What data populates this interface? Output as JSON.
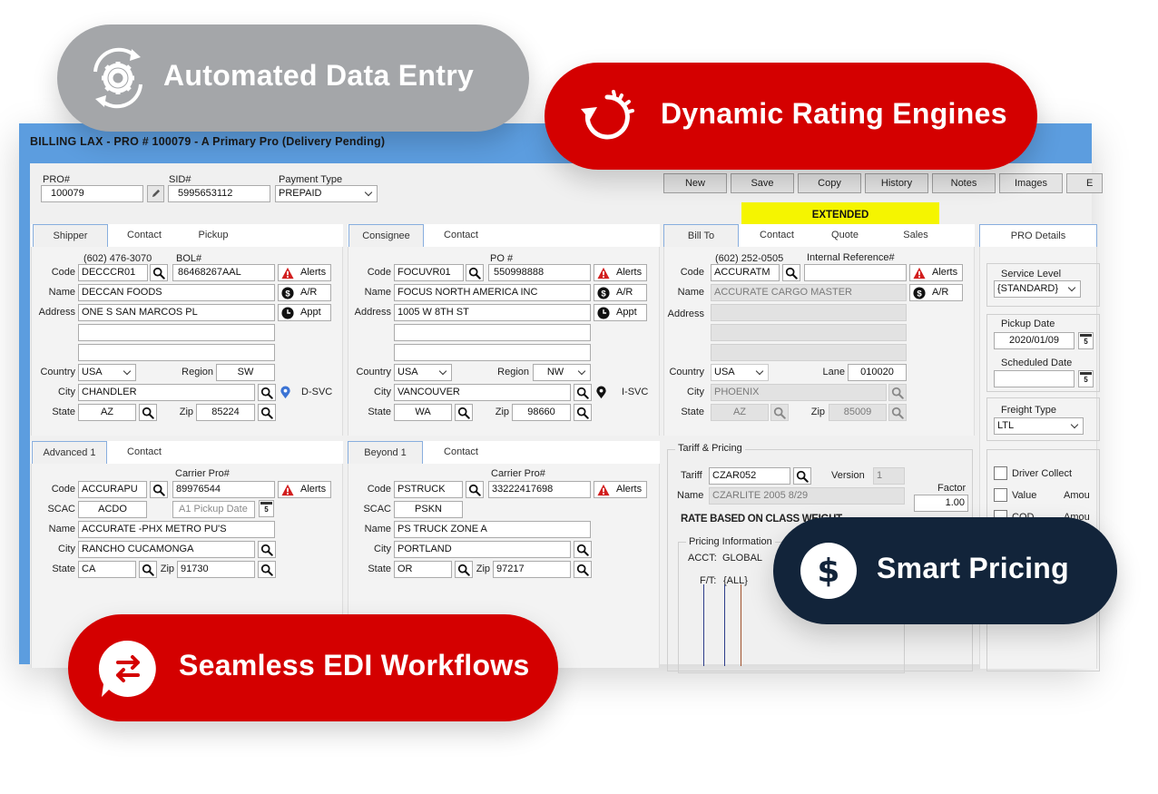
{
  "badges": {
    "automated": {
      "label": "Automated Data Entry",
      "color": "#a4a6a9",
      "icon": "gear-sync-icon"
    },
    "dynamic": {
      "label": "Dynamic Rating Engines",
      "color": "#d40000",
      "icon": "speed-refresh-icon"
    },
    "smart": {
      "label": "Smart Pricing",
      "color": "#12243a",
      "icon": "dollar-icon"
    },
    "edi": {
      "label": "Seamless EDI Workflows",
      "color": "#d40000",
      "icon": "exchange-chat-icon"
    }
  },
  "window": {
    "title": "BILLING  LAX - PRO # 100079 - A Primary Pro (Delivery Pending)"
  },
  "header": {
    "pro_label": "PRO#",
    "pro_value": "100079",
    "sid_label": "SID#",
    "sid_value": "5995653112",
    "payment_label": "Payment Type",
    "payment_value": "PREPAID"
  },
  "toolbar": {
    "new": "New",
    "save": "Save",
    "copy": "Copy",
    "history": "History",
    "notes": "Notes",
    "images": "Images",
    "more": "E"
  },
  "status": "EXTENDED",
  "labels": {
    "code": "Code",
    "name": "Name",
    "address": "Address",
    "country": "Country",
    "region": "Region",
    "city": "City",
    "state": "State",
    "zip": "Zip",
    "scac": "SCAC",
    "lane": "Lane",
    "alerts": "Alerts",
    "ar": "A/R",
    "appt": "Appt",
    "carrier_pro": "Carrier Pro#"
  },
  "shipper": {
    "tabs": [
      "Shipper",
      "Contact",
      "Pickup"
    ],
    "phone": "(602) 476-3070",
    "ref_label": "BOL#",
    "code": "DECCCR01",
    "ref": "86468267AAL",
    "name": "DECCAN FOODS",
    "address": "ONE S SAN MARCOS PL",
    "country": "USA",
    "region": "SW",
    "city": "CHANDLER",
    "svc": "D-SVC",
    "state": "AZ",
    "zip": "85224"
  },
  "consignee": {
    "tabs": [
      "Consignee",
      "Contact"
    ],
    "ref_label": "PO #",
    "code": "FOCUVR01",
    "ref": "550998888",
    "name": "FOCUS NORTH AMERICA INC",
    "address": "1005 W 8TH ST",
    "country": "USA",
    "region": "NW",
    "city": "VANCOUVER",
    "svc": "I-SVC",
    "state": "WA",
    "zip": "98660"
  },
  "billto": {
    "tabs": [
      "Bill To",
      "Contact",
      "Quote",
      "Sales"
    ],
    "phone": "(602) 252-0505",
    "ref_label": "Internal Reference#",
    "code": "ACCURATM",
    "ref": "",
    "name": "ACCURATE CARGO MASTER",
    "country": "USA",
    "lane": "010020",
    "city": "PHOENIX",
    "state": "AZ",
    "zip": "85009"
  },
  "advanced": {
    "tabs": [
      "Advanced 1",
      "Contact"
    ],
    "code": "ACCURAPU",
    "carrier_pro": "89976544",
    "scac": "ACDO",
    "pickup_placeholder": "A1 Pickup Date",
    "name": "ACCURATE -PHX  METRO PU'S",
    "city": "RANCHO CUCAMONGA",
    "state": "CA",
    "zip": "91730"
  },
  "beyond": {
    "tabs": [
      "Beyond 1",
      "Contact"
    ],
    "code": "PSTRUCK",
    "carrier_pro": "33222417698",
    "scac": "PSKN",
    "name": "PS TRUCK ZONE A",
    "city": "PORTLAND",
    "state": "OR",
    "zip": "97217"
  },
  "tariff": {
    "group_title": "Tariff & Pricing",
    "tariff_label": "Tariff",
    "tariff": "CZAR052",
    "version_label": "Version",
    "version": "1",
    "name_label": "Name",
    "name": "CZARLITE 2005 8/29",
    "factor_label": "Factor",
    "factor": "1.00",
    "rate_basis": "RATE BASED ON CLASS WEIGHT",
    "pricing_title": "Pricing Information",
    "acct_label": "ACCT:",
    "acct": "GLOBAL",
    "ft_label": "F/T:",
    "ft": "{ALL}"
  },
  "pro_details": {
    "tab": "PRO Details",
    "service_level_label": "Service Level",
    "service_level": "{STANDARD}",
    "pickup_date_label": "Pickup Date",
    "pickup_date": "2020/01/09",
    "scheduled_date_label": "Scheduled Date",
    "scheduled_date": "",
    "freight_type_label": "Freight Type",
    "freight_type": "LTL",
    "driver_collect": "Driver Collect",
    "value": "Value",
    "cod": "COD",
    "amount": "Amou",
    "calendar_day": "5"
  }
}
